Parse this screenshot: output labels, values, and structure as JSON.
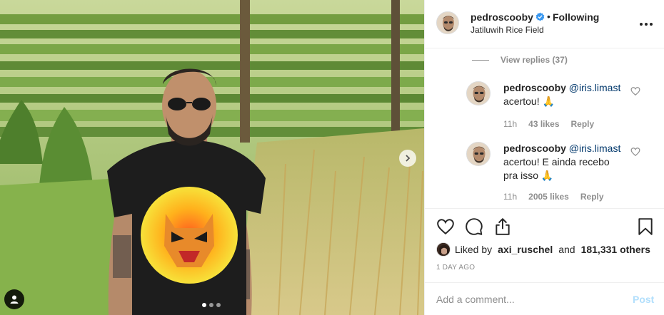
{
  "header": {
    "username": "pedroscooby",
    "separator": "•",
    "follow_status": "Following",
    "location": "Jatiluwih Rice Field"
  },
  "comments": {
    "view_replies": "View replies (37)",
    "replies": [
      {
        "username": "pedroscooby",
        "mention": "@iris.limast",
        "text": "acertou! 🙏",
        "time": "11h",
        "likes": "43 likes",
        "reply_label": "Reply"
      },
      {
        "username": "pedroscooby",
        "mention": "@iris.limast",
        "text": "acertou! E ainda recebo pra isso 🙏",
        "time": "11h",
        "likes": "2005 likes",
        "reply_label": "Reply"
      }
    ]
  },
  "likes": {
    "prefix": "Liked by",
    "user": "axi_ruschel",
    "conj": "and",
    "others": "181,331 others"
  },
  "timestamp": "1 DAY AGO",
  "comment_box": {
    "placeholder": "Add a comment...",
    "post_label": "Post"
  },
  "carousel": {
    "count": 3,
    "active_index": 0
  },
  "icons": {
    "heart": "heart-icon",
    "comment": "comment-icon",
    "share": "share-icon",
    "save": "bookmark-icon",
    "verified": "verified-badge-icon",
    "more": "more-options-icon",
    "tag": "user-tag-icon",
    "next": "chevron-right-icon"
  },
  "colors": {
    "verified": "#3897f0",
    "mention": "#00376b",
    "post_disabled": "#b2dffc",
    "muted": "#8e8e8e"
  }
}
